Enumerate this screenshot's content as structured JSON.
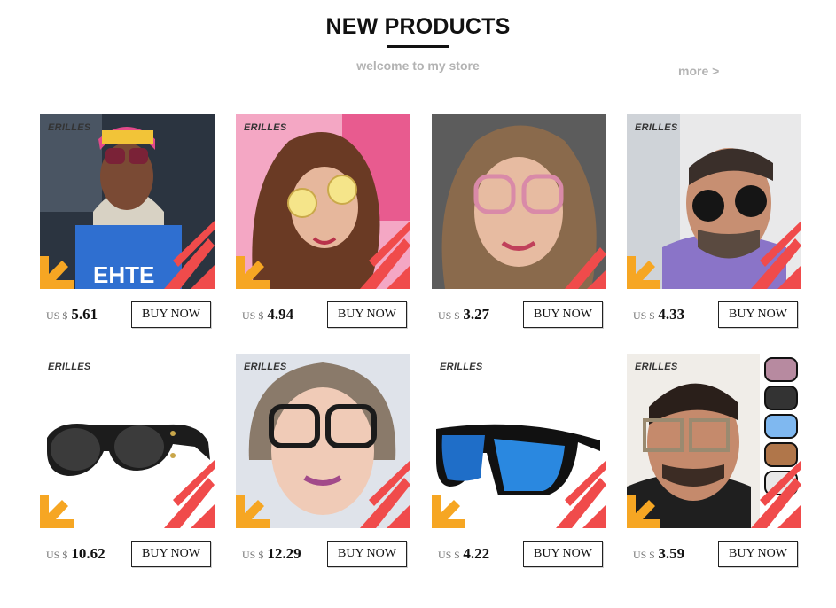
{
  "header": {
    "title": "NEW PRODUCTS",
    "subtitle": "welcome to my store",
    "more_label": "more >"
  },
  "colors": {
    "accent_red": "#f04b4b",
    "accent_yellow": "#f6a623",
    "text_gray": "#b3b3b3"
  },
  "products": [
    {
      "brand": "ERILLES",
      "currency": "US $",
      "price": "5.61",
      "buy_label": "BUY NOW",
      "image": "woman-blonde-wine-sunglasses"
    },
    {
      "brand": "ERILLES",
      "currency": "US $",
      "price": "4.94",
      "buy_label": "BUY NOW",
      "image": "woman-curly-yellow-lens-glasses"
    },
    {
      "brand": "",
      "currency": "US $",
      "price": "3.27",
      "buy_label": "BUY NOW",
      "image": "woman-pink-frame-glasses"
    },
    {
      "brand": "ERILLES",
      "currency": "US $",
      "price": "4.33",
      "buy_label": "BUY NOW",
      "image": "man-round-black-sunglasses"
    },
    {
      "brand": "ERILLES",
      "currency": "US $",
      "price": "10.62",
      "buy_label": "BUY NOW",
      "image": "black-steampunk-sunglasses"
    },
    {
      "brand": "ERILLES",
      "currency": "US $",
      "price": "12.29",
      "buy_label": "BUY NOW",
      "image": "woman-black-frame-glasses"
    },
    {
      "brand": "ERILLES",
      "currency": "US $",
      "price": "4.22",
      "buy_label": "BUY NOW",
      "image": "blue-mirror-square-sunglasses"
    },
    {
      "brand": "ERILLES",
      "currency": "US $",
      "price": "3.59",
      "buy_label": "BUY NOW",
      "image": "man-square-sunglasses-variants"
    }
  ]
}
